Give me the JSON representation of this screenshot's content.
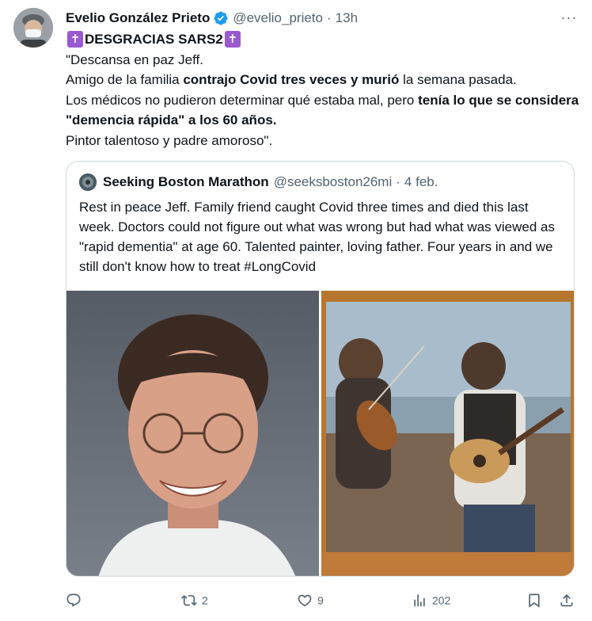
{
  "tweet": {
    "author_name": "Evelio González Prieto",
    "handle": "@evelio_prieto",
    "separator": "·",
    "time": "13h",
    "more_label": "···",
    "title": "DESGRACIAS SARS2",
    "cross_glyph": "✝",
    "lines": {
      "l1": "\"Descansa en paz Jeff.",
      "l2a": "Amigo de la familia ",
      "l2b": "contrajo Covid tres veces y murió",
      "l2c": " la semana pasada.",
      "l3a": "Los médicos no pudieron determinar qué estaba mal, pero ",
      "l3b": "tenía lo que se considera \"demencia rápida\" a los 60 años.",
      "l4": "Pintor talentoso y padre amoroso\"."
    }
  },
  "quoted": {
    "author_name": "Seeking Boston Marathon",
    "handle": "@seeksboston26mi",
    "separator": "·",
    "date": "4 feb.",
    "text": "Rest in peace Jeff. Family friend caught Covid three times and died this last week. Doctors could not figure out what was wrong but had what was viewed as \"rapid dementia\" at age 60. Talented painter, loving father. Four years in and we still don't know how to treat #LongCovid"
  },
  "actions": {
    "reply_count": "",
    "repost_count": "2",
    "like_count": "9",
    "views_count": "202"
  },
  "colors": {
    "text": "#0f1419",
    "secondary": "#536471",
    "verified": "#1d9bf0",
    "border": "#cfd9de"
  },
  "icons": [
    "avatar",
    "verified-badge-icon",
    "more-icon",
    "reply-icon",
    "repost-icon",
    "like-icon",
    "views-icon",
    "bookmark-icon",
    "share-icon"
  ]
}
